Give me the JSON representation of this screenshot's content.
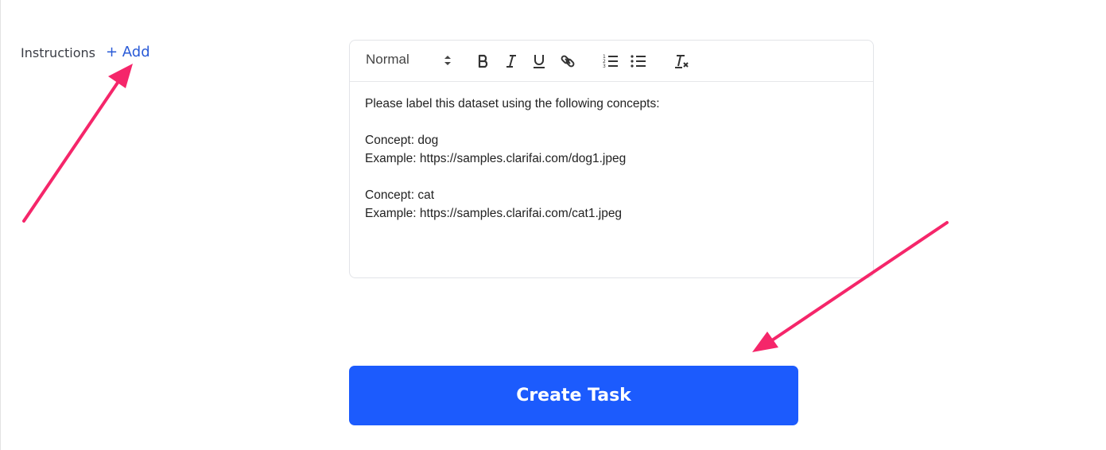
{
  "instructions": {
    "label": "Instructions",
    "add_label": "+ Add"
  },
  "editor": {
    "format_value": "Normal",
    "toolbar_icons": [
      "bold-icon",
      "italic-icon",
      "underline-icon",
      "link-icon",
      "ordered-list-icon",
      "bullet-list-icon",
      "clear-format-icon"
    ],
    "lines": [
      "Please label this dataset using the following concepts:",
      "",
      "Concept: dog",
      "Example: https://samples.clarifai.com/dog1.jpeg",
      "",
      "Concept: cat",
      "Example: https://samples.clarifai.com/cat1.jpeg"
    ]
  },
  "create_button": {
    "label": "Create Task"
  },
  "colors": {
    "accent": "#1c5bfd",
    "link": "#2a5bd7",
    "annotation_arrow": "#f5266a"
  }
}
